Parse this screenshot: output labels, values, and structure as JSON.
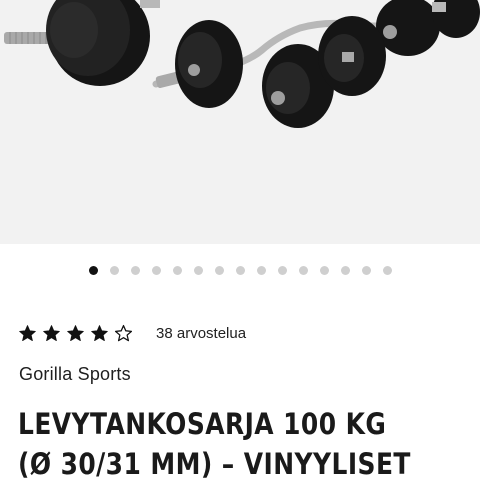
{
  "product": {
    "image": {
      "alt": "",
      "background": "#f2f2f2",
      "plate_color": "#1a1a1a",
      "bar_color": "#b8b8b8"
    },
    "carousel": {
      "total": 15,
      "active_index": 0,
      "active_color": "#111111",
      "inactive_color": "#cfcfcf"
    },
    "rating": {
      "stars": 4,
      "max_stars": 5,
      "count_label": "38 arvostelua"
    },
    "brand": "Gorilla Sports",
    "title_lines": [
      "LEVYTANKOSARJA 100 KG",
      "(Ø 30/31 MM) – VINYYLISET"
    ]
  }
}
